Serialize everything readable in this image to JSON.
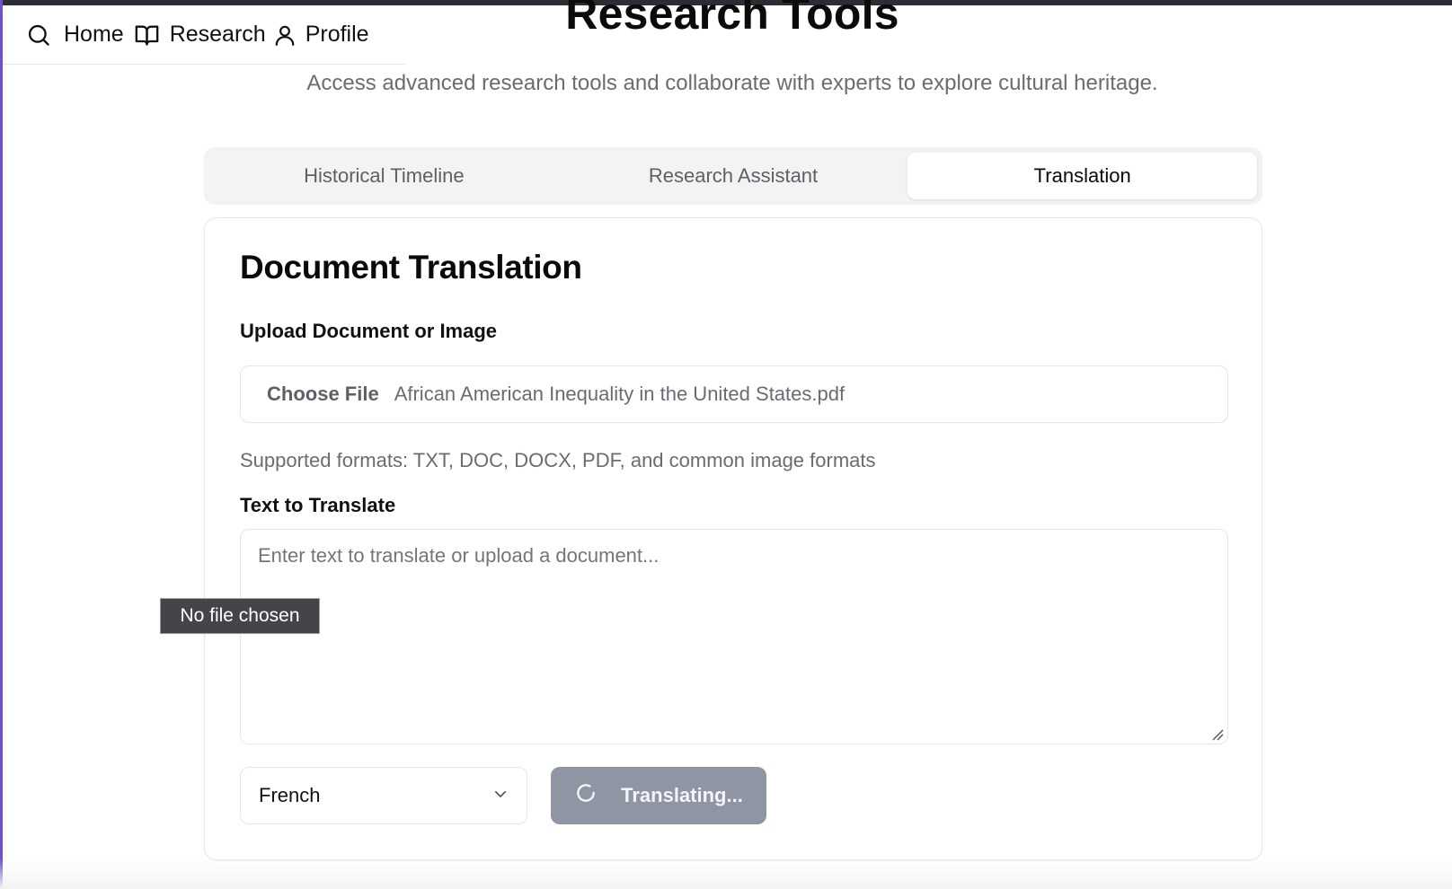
{
  "nav": {
    "items": [
      {
        "label": "Home",
        "icon": "search-icon"
      },
      {
        "label": "Research",
        "icon": "book-open-icon"
      },
      {
        "label": "Profile",
        "icon": "user-icon"
      }
    ]
  },
  "header": {
    "title": "Research Tools",
    "subtitle": "Access advanced research tools and collaborate with experts to explore cultural heritage."
  },
  "tabs": [
    {
      "label": "Historical Timeline",
      "active": false
    },
    {
      "label": "Research Assistant",
      "active": false
    },
    {
      "label": "Translation",
      "active": true
    }
  ],
  "card": {
    "title": "Document Translation",
    "upload": {
      "label": "Upload Document or Image",
      "button_label": "Choose File",
      "file_name": "African American Inequality in the United States.pdf",
      "hint": "Supported formats: TXT, DOC, DOCX, PDF, and common image formats"
    },
    "text": {
      "label": "Text to Translate",
      "placeholder": "Enter text to translate or upload a document...",
      "value": ""
    },
    "language": {
      "selected": "French"
    },
    "translate_button": {
      "label": "Translating..."
    }
  },
  "tooltip": {
    "text": "No file chosen"
  },
  "colors": {
    "button_disabled": "#8f95a3",
    "tab_bar": "#f3f3f4",
    "muted_text": "#6b6b73"
  }
}
